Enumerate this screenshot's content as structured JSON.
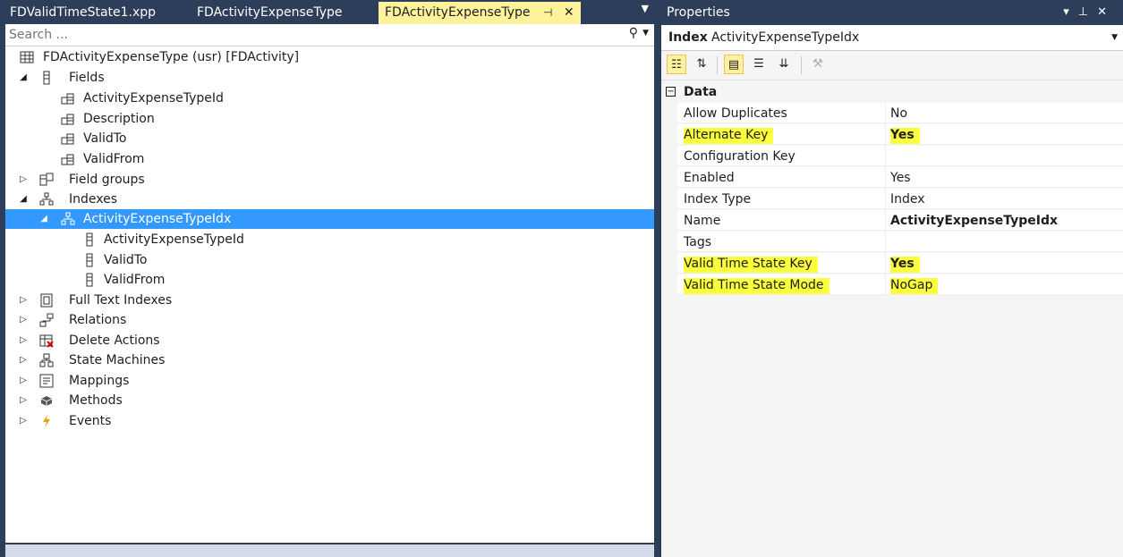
{
  "tabs": [
    {
      "label": "FDValidTimeState1.xpp"
    },
    {
      "label": "FDActivityExpenseType"
    },
    {
      "label": "FDActivityExpenseType"
    }
  ],
  "search": {
    "placeholder": "Search ..."
  },
  "tree": {
    "root": "FDActivityExpenseType (usr) [FDActivity]",
    "fields": "Fields",
    "field_items": [
      "ActivityExpenseTypeId",
      "Description",
      "ValidTo",
      "ValidFrom"
    ],
    "field_groups": "Field groups",
    "indexes": "Indexes",
    "index_name": "ActivityExpenseTypeIdx",
    "index_items": [
      "ActivityExpenseTypeId",
      "ValidTo",
      "ValidFrom"
    ],
    "full_text_indexes": "Full Text Indexes",
    "relations": "Relations",
    "delete_actions": "Delete Actions",
    "state_machines": "State Machines",
    "mappings": "Mappings",
    "methods": "Methods",
    "events": "Events"
  },
  "properties": {
    "title": "Properties",
    "object_kind": "Index",
    "object_name": "ActivityExpenseTypeIdx",
    "category": "Data",
    "rows": [
      {
        "name": "Allow Duplicates",
        "value": "No"
      },
      {
        "name": "Alternate Key",
        "value": "Yes"
      },
      {
        "name": "Configuration Key",
        "value": ""
      },
      {
        "name": "Enabled",
        "value": "Yes"
      },
      {
        "name": "Index Type",
        "value": "Index"
      },
      {
        "name": "Name",
        "value": "ActivityExpenseTypeIdx"
      },
      {
        "name": "Tags",
        "value": ""
      },
      {
        "name": "Valid Time State Key",
        "value": "Yes"
      },
      {
        "name": "Valid Time State Mode",
        "value": "NoGap"
      }
    ]
  },
  "colors": {
    "highlight": "#fcff3c",
    "selection": "#3399ff",
    "chrome": "#2d3e5a",
    "active_tab": "#fff29d"
  }
}
